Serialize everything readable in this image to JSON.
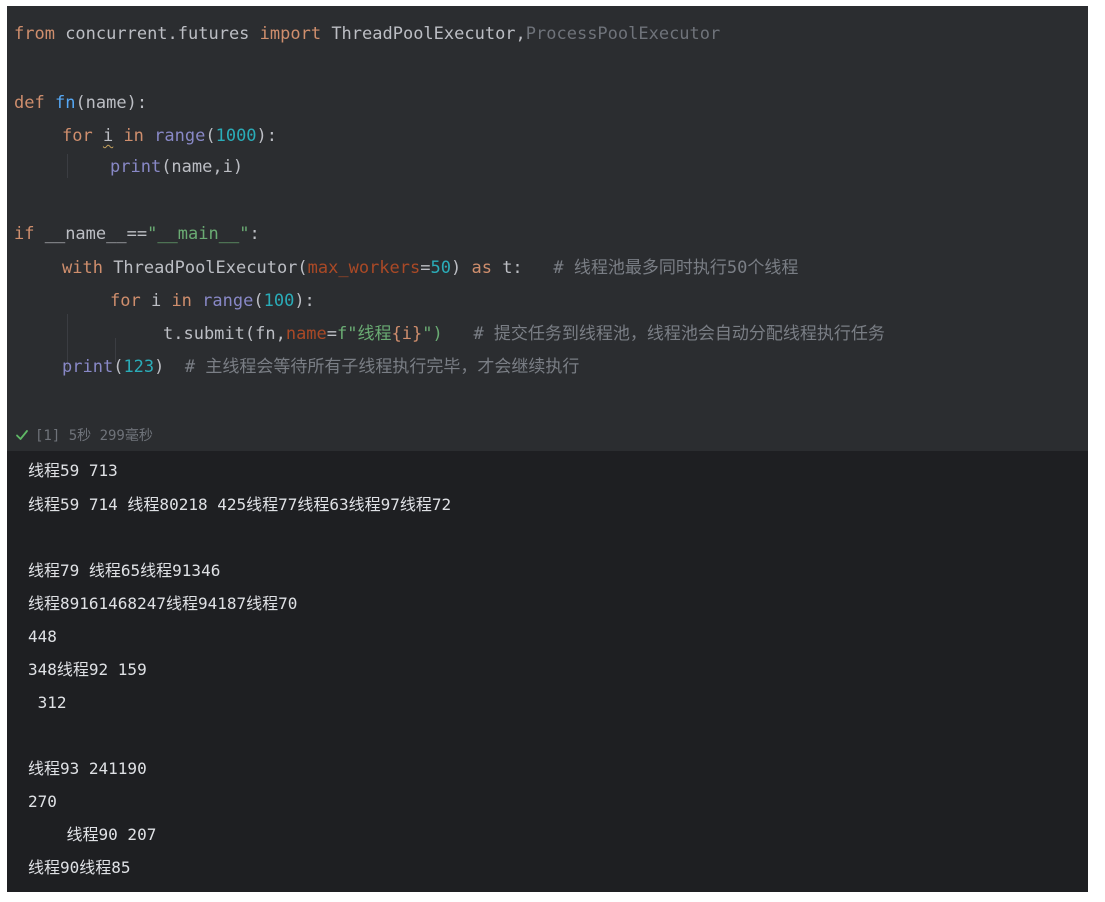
{
  "editor": {
    "lines": {
      "l1": {
        "kw_from": "from",
        "mod": " concurrent.futures ",
        "kw_import": "import",
        "cls1": " ThreadPoolExecutor,",
        "cls2": "ProcessPoolExecutor"
      },
      "l3": {
        "kw_def": "def ",
        "fn": "fn",
        "rest": "(name):"
      },
      "l4": {
        "kw_for": "for ",
        "var": "i",
        "kw_in": " in ",
        "builtin": "range",
        "p1": "(",
        "num": "1000",
        "p2": "):"
      },
      "l5": {
        "builtin": "print",
        "rest": "(name,i)"
      },
      "l7": {
        "kw_if": "if ",
        "rest": "__name__==",
        "str": "\"__main__\"",
        "colon": ":"
      },
      "l8": {
        "kw_with": "with ",
        "cls": "ThreadPoolExecutor(",
        "param": "max_workers",
        "eq": "=",
        "num": "50",
        "close": ") ",
        "kw_as": "as ",
        "var": "t:",
        "comment": "# 线程池最多同时执行50个线程"
      },
      "l9": {
        "kw_for": "for ",
        "var": "i",
        "kw_in": " in ",
        "builtin": "range",
        "p1": "(",
        "num": "100",
        "p2": "):"
      },
      "l10": {
        "pre": "t.submit(fn,",
        "param": "name",
        "eq": "=",
        "str1": "f\"线程",
        "brace": "{i}",
        "str2": "\")",
        "comment": "# 提交任务到线程池，线程池会自动分配线程执行任务"
      },
      "l11": {
        "builtin": "print",
        "p1": "(",
        "num": "123",
        "p2": ")",
        "comment": "# 主线程会等待所有子线程执行完毕，才会继续执行"
      }
    }
  },
  "status": {
    "text": "[1] 5秒 299毫秒"
  },
  "output": {
    "lines": [
      "线程59 713",
      "线程59 714 线程80218 425线程77线程63线程97线程72",
      "",
      "线程79 线程65线程91346",
      "线程89161468247线程94187线程70",
      "448",
      "348线程92 159",
      " 312",
      "",
      "线程93 241190",
      "270",
      "    线程90 207",
      "线程90线程85"
    ]
  }
}
